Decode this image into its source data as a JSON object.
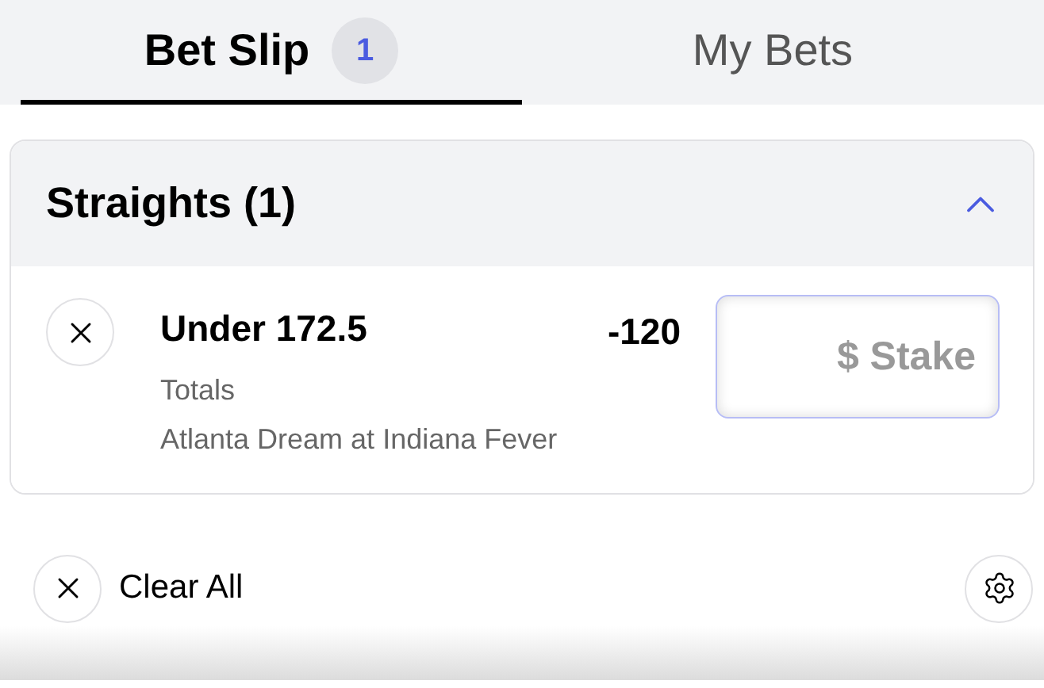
{
  "tabs": [
    {
      "label": "Bet Slip",
      "badge": "1",
      "selected": true
    },
    {
      "label": "My Bets",
      "selected": false
    }
  ],
  "section": {
    "title": "Straights (1)",
    "expanded": true,
    "bets": [
      {
        "selection": "Under 172.5",
        "odds": "-120",
        "market": "Totals",
        "event": "Atlanta Dream at Indiana Fever",
        "stake": {
          "placeholder": "$ Stake"
        }
      }
    ]
  },
  "footer": {
    "clear_label": "Clear All"
  }
}
